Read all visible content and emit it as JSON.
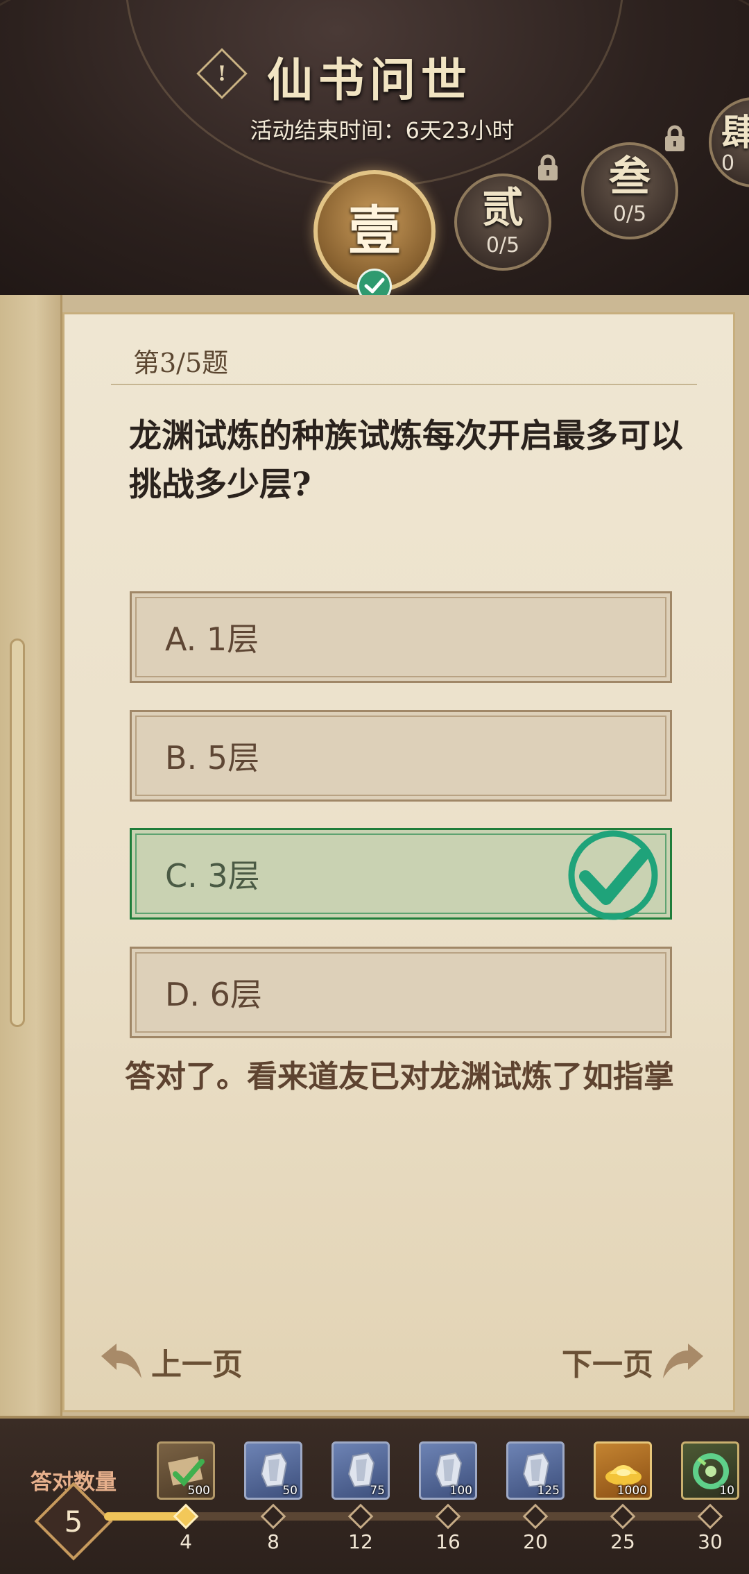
{
  "header": {
    "title": "仙书问世",
    "countdown": "活动结束时间：6天23小时",
    "chapters": [
      {
        "label": "壹",
        "progress": "",
        "state": "completed"
      },
      {
        "label": "贰",
        "progress": "0/5",
        "state": "locked"
      },
      {
        "label": "叁",
        "progress": "0/5",
        "state": "locked"
      },
      {
        "label": "肆",
        "progress": "0",
        "state": "locked"
      }
    ]
  },
  "quiz": {
    "number": "第3/5题",
    "question": "龙渊试炼的种族试炼每次开启最多可以挑战多少层?",
    "options": [
      {
        "label": "A. 1层",
        "correct": false
      },
      {
        "label": "B. 5层",
        "correct": false
      },
      {
        "label": "C. 3层",
        "correct": true
      },
      {
        "label": "D. 6层",
        "correct": false
      }
    ],
    "feedback": "答对了。看来道友已对龙渊试炼了如指掌",
    "prev_label": "上一页",
    "next_label": "下一页"
  },
  "rewards": {
    "count_label": "答对数量",
    "count_value": "5",
    "milestones": [
      {
        "label": "4",
        "reached": true
      },
      {
        "label": "8",
        "reached": false
      },
      {
        "label": "12",
        "reached": false
      },
      {
        "label": "16",
        "reached": false
      },
      {
        "label": "20",
        "reached": false
      },
      {
        "label": "25",
        "reached": false
      },
      {
        "label": "30",
        "reached": false
      }
    ],
    "items": [
      {
        "qty": "500",
        "icon": "book-icon"
      },
      {
        "qty": "50",
        "icon": "silver-ore-icon"
      },
      {
        "qty": "75",
        "icon": "silver-ore-icon"
      },
      {
        "qty": "100",
        "icon": "silver-ore-icon"
      },
      {
        "qty": "125",
        "icon": "silver-ore-icon"
      },
      {
        "qty": "1000",
        "icon": "gold-ingot-icon"
      },
      {
        "qty": "10",
        "icon": "jade-dragon-icon"
      }
    ]
  },
  "colors": {
    "correct_border": "#1f7d3a",
    "correct_check": "#1fa37a",
    "progress_fill": "#efc45a"
  }
}
